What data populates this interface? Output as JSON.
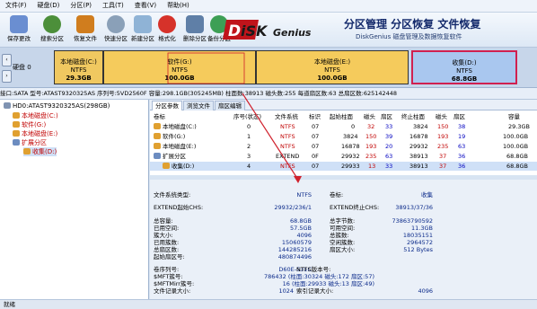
{
  "menu": [
    "文件(F)",
    "硬盘(D)",
    "分区(P)",
    "工具(T)",
    "查看(V)",
    "帮助(H)"
  ],
  "toolbar": [
    {
      "label": "保存更改",
      "icon": "save-icon",
      "color": "#6a8ed1"
    },
    {
      "label": "搜索分区",
      "icon": "search-partition-icon",
      "color": "#4c8f3a"
    },
    {
      "label": "恢复文件",
      "icon": "recover-file-icon",
      "color": "#d07d1e"
    },
    {
      "label": "快速分区",
      "icon": "quick-partition-icon",
      "color": "#8aa0b8"
    },
    {
      "label": "新建分区",
      "icon": "new-partition-icon",
      "color": "#8fb3d6"
    },
    {
      "label": "格式化",
      "icon": "format-icon",
      "color": "#d6322a"
    },
    {
      "label": "删除分区",
      "icon": "delete-partition-icon",
      "color": "#5f7fa7"
    },
    {
      "label": "备份分区",
      "icon": "backup-partition-icon",
      "color": "#3d9f55"
    }
  ],
  "brand": {
    "logo": "DiskGenius",
    "title": "分区管理 分区恢复 文件恢复",
    "subtitle": "DiskGenius 磁盘管理及数据恢复软件"
  },
  "diskmap": {
    "disk_label": "硬盘 0",
    "partitions": [
      {
        "name": "本地磁盘(C:)",
        "fs": "NTFS",
        "size": "29.3GB",
        "color": "#f0c860"
      },
      {
        "name": "软件(G:)",
        "fs": "NTFS",
        "size": "100.0GB",
        "color": "#f5cb5c"
      },
      {
        "name": "本地磁盘(E:)",
        "fs": "NTFS",
        "size": "100.0GB",
        "color": "#f5cb5c"
      },
      {
        "name": "收集(D:)",
        "fs": "NTFS",
        "size": "68.8GB",
        "color": "#a9c7ef"
      }
    ]
  },
  "infoline": "接口:SATA  型号:ATAST9320325AS  序列号:5VD2560F  容量:298.1GB(305245MB)  柱面数:38913  磁头数:255  每道扇区数:63  总扇区数:625142448",
  "tree": {
    "root": "HD0:ATAST9320325AS(298GB)",
    "items": [
      "本地磁盘(C:)",
      "软件(G:)",
      "本地磁盘(E:)",
      "扩展分区",
      "收集(D:)"
    ]
  },
  "tabs": [
    "分区参数",
    "浏览文件",
    "扇区编辑"
  ],
  "table": {
    "headers": [
      "卷标",
      "序号(状态)",
      "文件系统",
      "标识",
      "起始柱面",
      "磁头",
      "扇区",
      "终止柱面",
      "磁头",
      "扇区",
      "容量"
    ],
    "rows": [
      {
        "label": "本地磁盘(C:)",
        "cells": [
          "0",
          "NTFS",
          "07",
          "0",
          "32",
          "33",
          "3824",
          "150",
          "38",
          "29.3GB"
        ]
      },
      {
        "label": "软件(G:)",
        "cells": [
          "1",
          "NTFS",
          "07",
          "3824",
          "150",
          "39",
          "16878",
          "193",
          "19",
          "100.0GB"
        ]
      },
      {
        "label": "本地磁盘(E:)",
        "cells": [
          "2",
          "NTFS",
          "07",
          "16878",
          "193",
          "20",
          "29932",
          "235",
          "63",
          "100.0GB"
        ]
      },
      {
        "label": "扩展分区",
        "cells": [
          "3",
          "EXTEND",
          "0F",
          "29932",
          "235",
          "63",
          "38913",
          "37",
          "36",
          "68.8GB"
        ]
      },
      {
        "label": "收集(D:)",
        "cells": [
          "4",
          "NTFS",
          "07",
          "29933",
          "13",
          "33",
          "38913",
          "37",
          "36",
          "68.8GB"
        ]
      }
    ]
  },
  "details": {
    "fs_type_label": "文件系统类型:",
    "fs_type": "NTFS",
    "volume_label_label": "卷标:",
    "volume_label": "收集",
    "extend_start_label": "EXTEND起始CHS:",
    "extend_start": "29932/236/1",
    "extend_end_label": "EXTEND终止CHS:",
    "extend_end": "38913/37/36",
    "left": [
      {
        "k": "总容量:",
        "v": "68.8GB"
      },
      {
        "k": "已用空间:",
        "v": "57.5GB"
      },
      {
        "k": "簇大小:",
        "v": "4096"
      },
      {
        "k": "已用簇数:",
        "v": "15060579"
      },
      {
        "k": "总扇区数:",
        "v": "144285216"
      },
      {
        "k": "起始扇区号:",
        "v": "480874496"
      }
    ],
    "right": [
      {
        "k": "总字节数:",
        "v": "73863790592"
      },
      {
        "k": "可用空间:",
        "v": "11.3GB"
      },
      {
        "k": "总簇数:",
        "v": "18035151"
      },
      {
        "k": "空闲簇数:",
        "v": "2964572"
      },
      {
        "k": "扇区大小:",
        "v": "512 Bytes"
      }
    ],
    "serial_label": "卷序列号:",
    "serial": "D60E-531C",
    "ntfs_ver_label": "NTFS版本号:",
    "ntfs_ver": "",
    "mft_label": "$MFT簇号:",
    "mft": "786432 (柱面:30324 磁头:172 扇区:57)",
    "mftmirr_label": "$MFTMirr簇号:",
    "mftmirr": "16 (柱面:29933 磁头:13 扇区:49)",
    "record_label": "文件记录大小:",
    "record": "1024",
    "index_label": "索引记录大小:",
    "index": "4096"
  },
  "status": "就绪"
}
